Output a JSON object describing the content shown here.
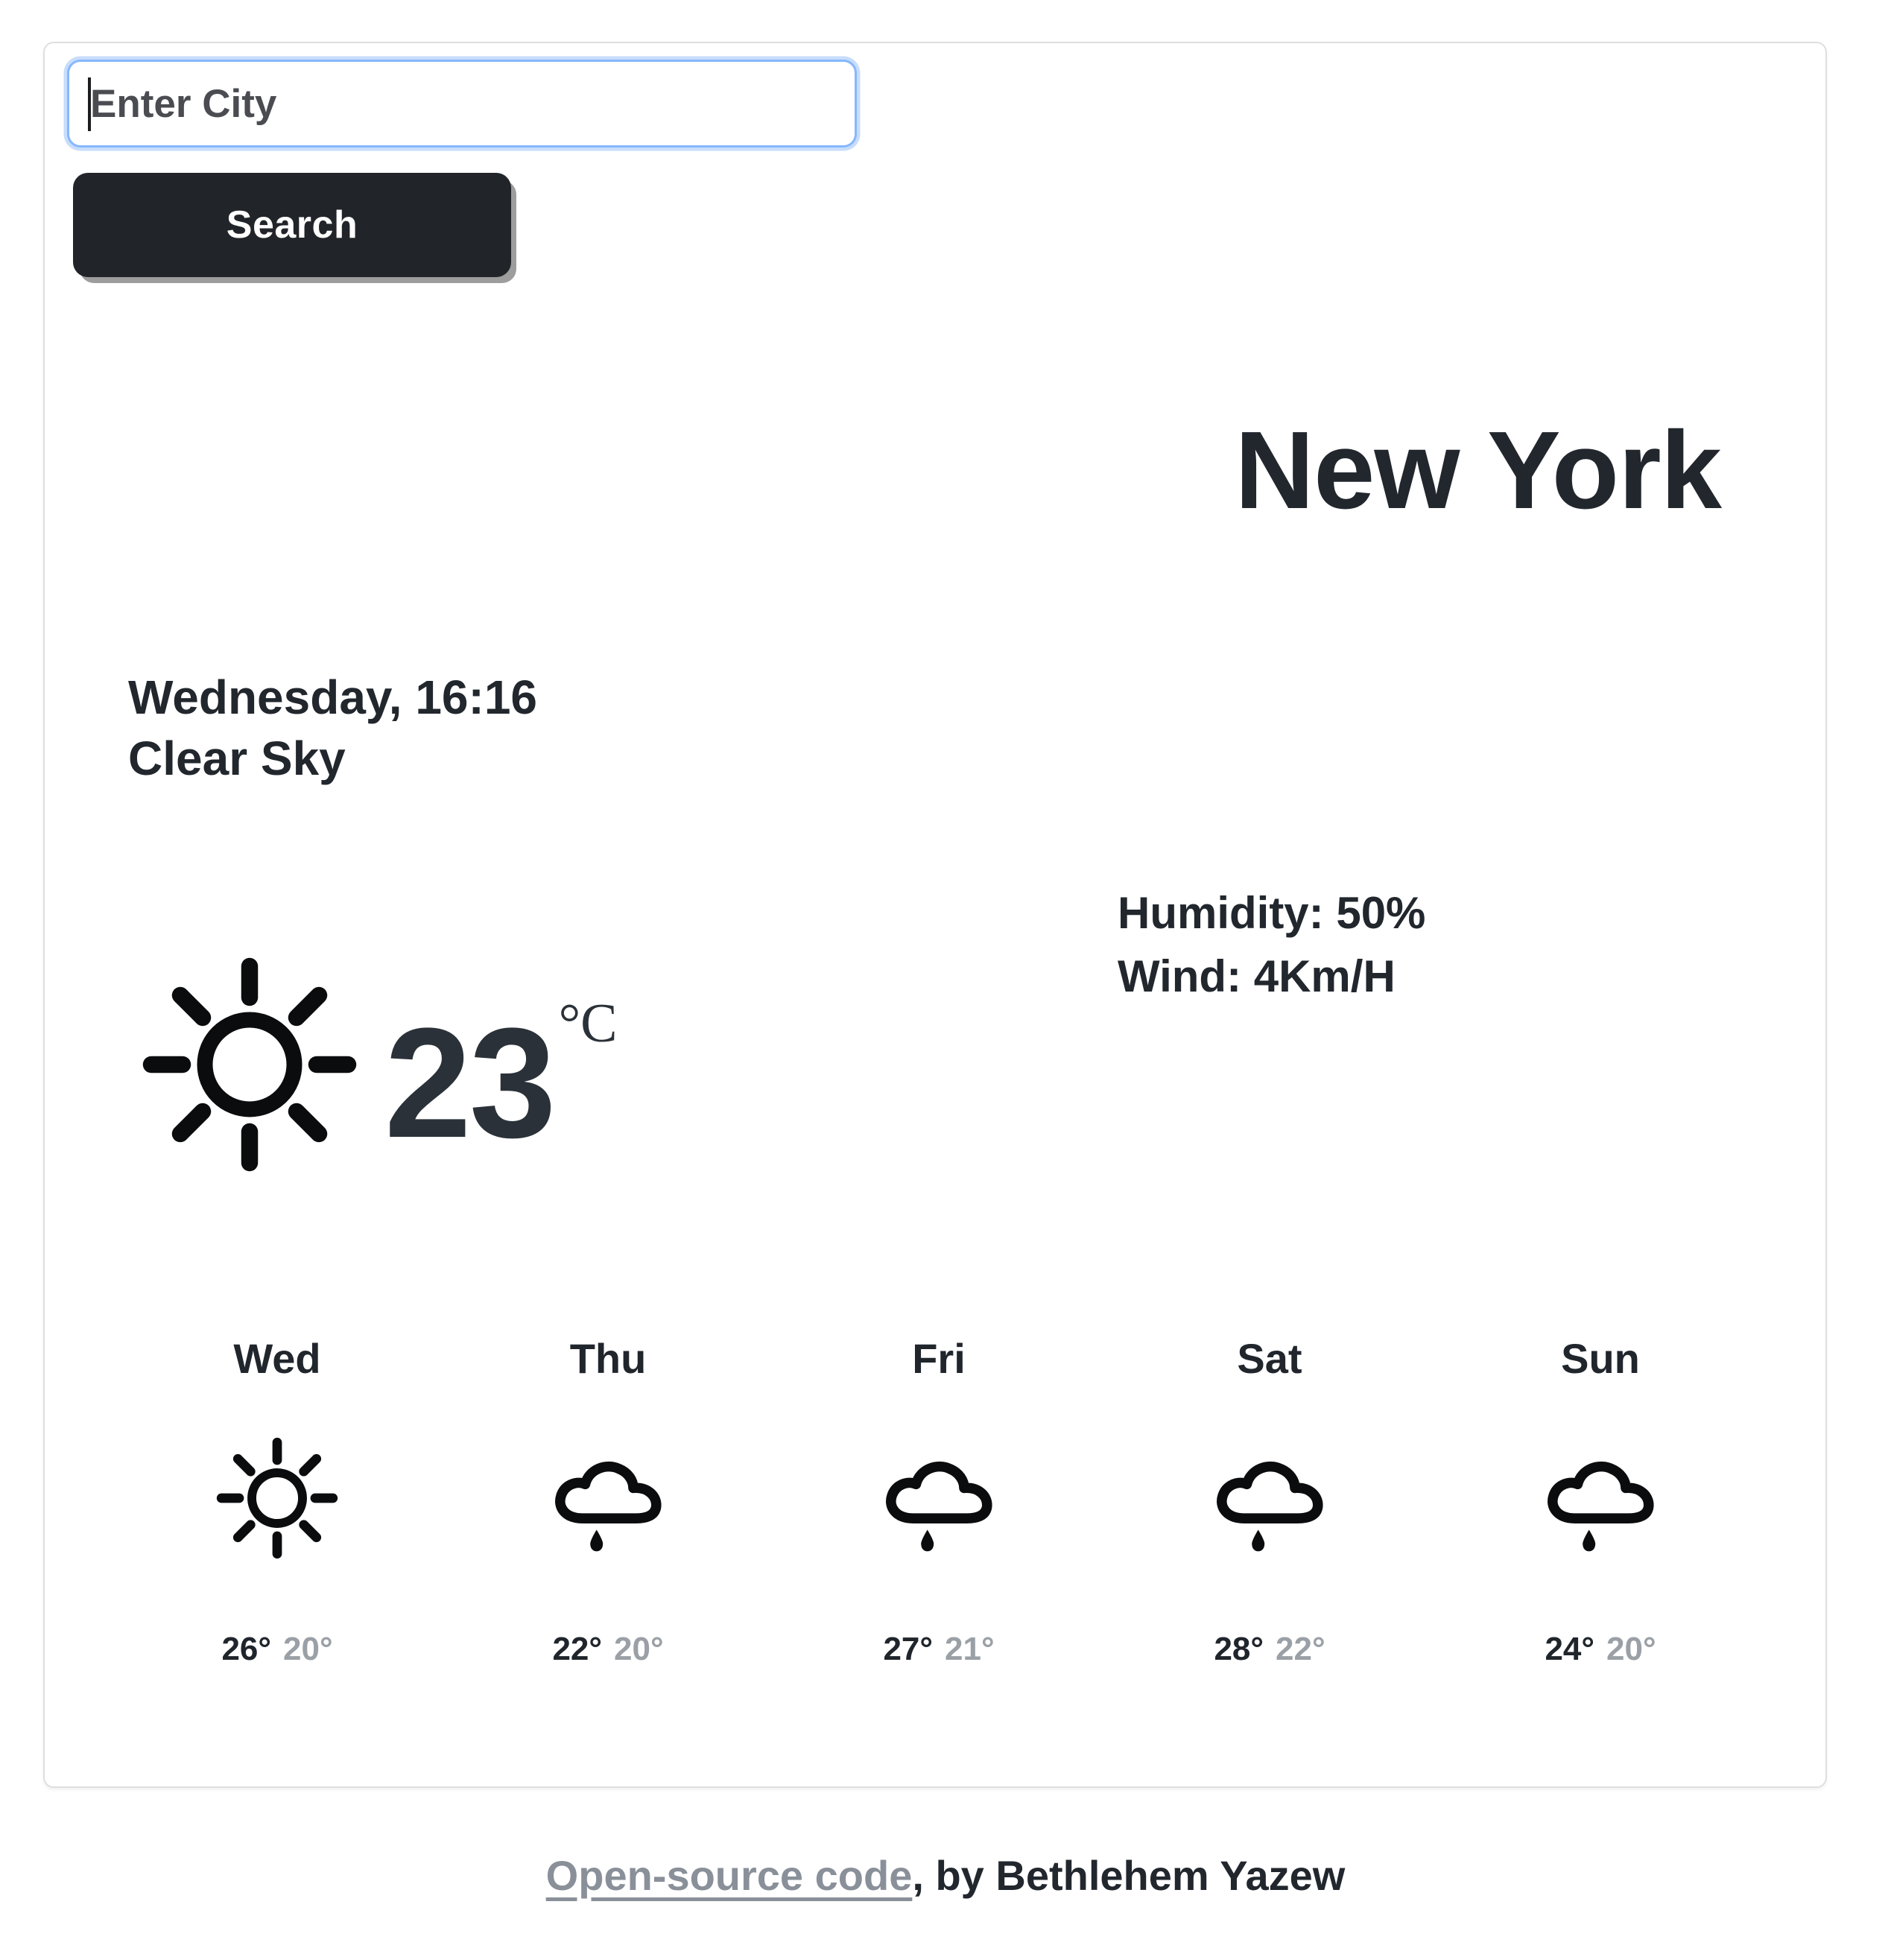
{
  "search": {
    "placeholder": "Enter City",
    "value": "",
    "button_label": "Search"
  },
  "current": {
    "city": "New York",
    "datetime": "Wednesday, 16:16",
    "condition": "Clear Sky",
    "humidity": "Humidity: 50%",
    "wind": "Wind: 4Km/H",
    "temperature": "23",
    "unit": "°C",
    "icon": "sun-icon"
  },
  "forecast": [
    {
      "day": "Wed",
      "icon": "sun-icon",
      "high": "26°",
      "low": "20°"
    },
    {
      "day": "Thu",
      "icon": "rain-cloud-icon",
      "high": "22°",
      "low": "20°"
    },
    {
      "day": "Fri",
      "icon": "rain-cloud-icon",
      "high": "27°",
      "low": "21°"
    },
    {
      "day": "Sat",
      "icon": "rain-cloud-icon",
      "high": "28°",
      "low": "22°"
    },
    {
      "day": "Sun",
      "icon": "rain-cloud-icon",
      "high": "24°",
      "low": "20°"
    }
  ],
  "footer": {
    "link_text": "Open-source code",
    "credit_text": ", by Bethlehem Yazew"
  },
  "colors": {
    "text_dark": "#22272e",
    "muted": "#9aa0a6",
    "button_bg": "#212529",
    "focus_border": "#86b7fe",
    "card_border": "#dfdfdf"
  }
}
